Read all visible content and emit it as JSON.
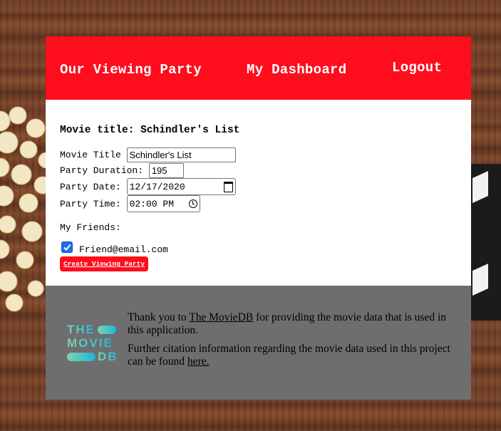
{
  "nav": {
    "viewing_party": "Our Viewing Party",
    "dashboard": "My Dashboard",
    "logout": "Logout"
  },
  "form": {
    "heading_prefix": "Movie title: ",
    "heading_movie": "Schindler's List",
    "movie_title_label": "Movie Title ",
    "movie_title_value": "Schindler's List",
    "duration_label": "Party Duration: ",
    "duration_value": "195",
    "date_label": "Party Date: ",
    "date_value": "12/17/2020",
    "time_label": "Party Time: ",
    "time_value": "02:00 PM",
    "friends_label": "My Friends:",
    "friends": [
      {
        "email": "Friend@email.com",
        "checked": true
      }
    ],
    "submit_label": "Create Viewing Party"
  },
  "footer": {
    "thanks_before": "Thank you to ",
    "moviedb_link": "The MovieDB",
    "thanks_after": " for providing the movie data that is used in this application.",
    "citation_text": "Further citation information regarding the movie data used in this project can be found ",
    "here_link": "here.",
    "logo": {
      "line1": "THE",
      "line2": "MOVIE",
      "line3": "DB"
    }
  },
  "colors": {
    "brand_red": "#fe0d1d",
    "footer_gray": "#6e6e6e",
    "checkbox_blue": "#1f6fe6",
    "logo_gradient_start": "#7ed3b0",
    "logo_gradient_end": "#1fb4df"
  }
}
